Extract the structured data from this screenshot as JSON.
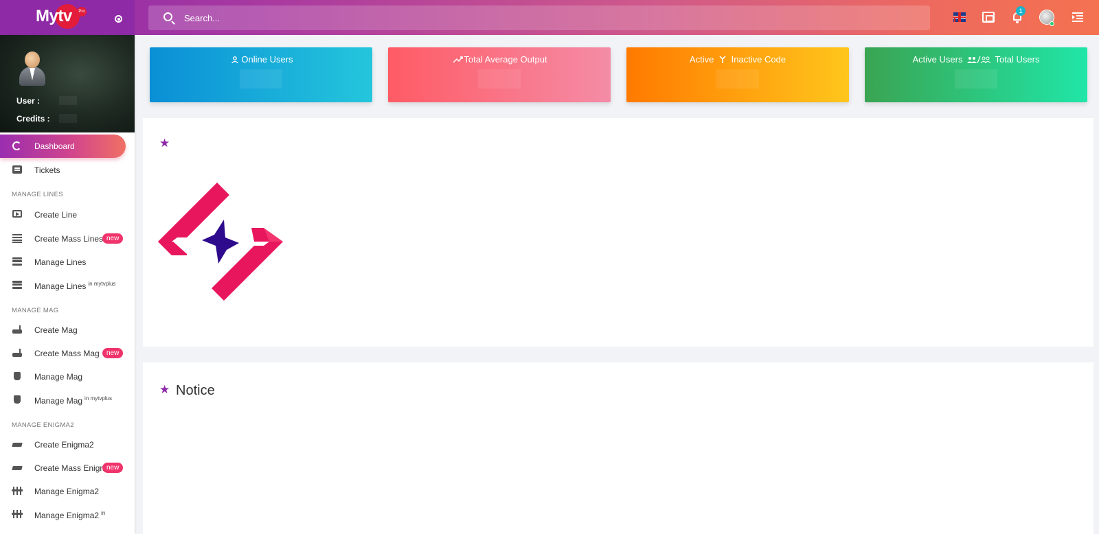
{
  "app": {
    "logo_text_my": "My",
    "logo_text_tv": "tv",
    "logo_badge": "Pro"
  },
  "search": {
    "placeholder": "Search..."
  },
  "header": {
    "notification_count": "1",
    "icons": [
      "target-icon",
      "search-icon",
      "uk-flag-icon",
      "fullscreen-icon",
      "bell-icon",
      "avatar-icon",
      "menu-collapse-icon"
    ]
  },
  "user_panel": {
    "user_label": "User :",
    "credits_label": "Credits :"
  },
  "sidebar": {
    "items": [
      {
        "label": "Dashboard",
        "icon": "ring-icon",
        "active": true
      },
      {
        "label": "Tickets",
        "icon": "ticket-icon"
      }
    ],
    "sections": [
      {
        "title": "MANAGE LINES",
        "items": [
          {
            "label": "Create Line",
            "icon": "tv-play-icon"
          },
          {
            "label": "Create Mass Lines",
            "icon": "list-icon",
            "badge": "new"
          },
          {
            "label": "Manage Lines",
            "icon": "server-icon"
          },
          {
            "label": "Manage Lines",
            "icon": "server-icon",
            "sup": "in mytvplus"
          }
        ]
      },
      {
        "title": "MANAGE MAG",
        "items": [
          {
            "label": "Create Mag",
            "icon": "router-icon"
          },
          {
            "label": "Create Mass Mag",
            "icon": "router-icon",
            "badge": "new"
          },
          {
            "label": "Manage Mag",
            "icon": "set-top-box-icon"
          },
          {
            "label": "Manage Mag",
            "icon": "set-top-box-icon",
            "sup": "in mytvplus"
          }
        ]
      },
      {
        "title": "MANAGE ENIGMA2",
        "items": [
          {
            "label": "Create Enigma2",
            "icon": "receiver-icon"
          },
          {
            "label": "Create Mass Enigm",
            "icon": "receiver-icon",
            "badge": "new"
          },
          {
            "label": "Manage Enigma2",
            "icon": "equalizer-icon"
          },
          {
            "label": "Manage Enigma2",
            "icon": "equalizer-icon",
            "sup": "in"
          }
        ]
      }
    ]
  },
  "cards": [
    {
      "title": "Online Users",
      "color_from": "#0a8fd6",
      "color_to": "#25c6dc"
    },
    {
      "title": "Total Average Output",
      "color_from": "#ff5b65",
      "color_to": "#f48ca6"
    },
    {
      "title_a": "Active",
      "title_b": "Inactive Code",
      "color_from": "#ff7a00",
      "color_to": "#ffc61c"
    },
    {
      "title_a": "Active Users",
      "title_b": "Total Users",
      "color_from": "#3aa452",
      "color_to": "#20e6a7"
    }
  ],
  "panels": {
    "notice_title": "Notice"
  },
  "colors": {
    "accent": "#8e2aa8",
    "badge": "#f0336b",
    "logo_red": "#e8175d",
    "logo_navy": "#2e0a8c"
  }
}
